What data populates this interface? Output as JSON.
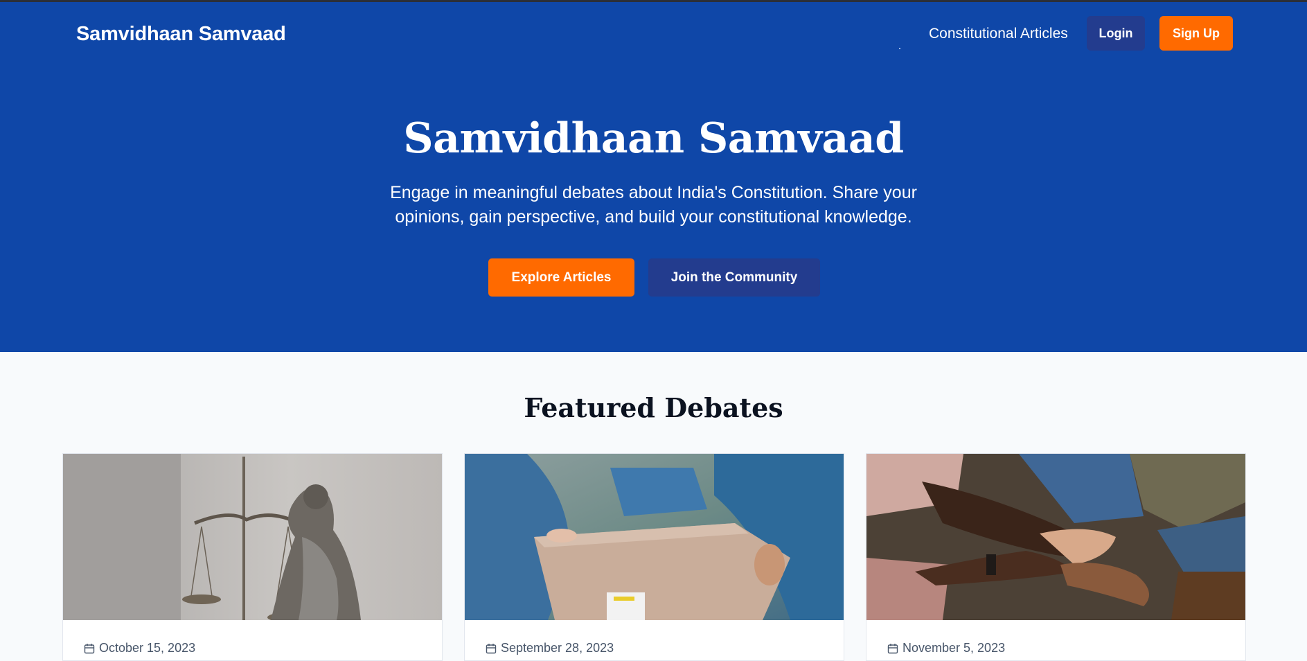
{
  "nav": {
    "brand": "Samvidhaan Samvaad",
    "articles_link": "Constitutional Articles",
    "login_label": "Login",
    "signup_label": "Sign Up"
  },
  "hero": {
    "title": "Samvidhaan Samvaad",
    "subtitle": "Engage in meaningful debates about India's Constitution. Share your opinions, gain perspective, and build your constitutional knowledge.",
    "explore_label": "Explore Articles",
    "join_label": "Join the Community"
  },
  "featured": {
    "title": "Featured Debates",
    "cards": [
      {
        "image": "lady-justice-statue",
        "date": "October 15, 2023"
      },
      {
        "image": "hands-passing-box",
        "date": "September 28, 2023"
      },
      {
        "image": "hands-stacked-together",
        "date": "November 5, 2023"
      }
    ]
  },
  "colors": {
    "primary_blue": "#0f47a8",
    "dark_blue_button": "#233c8e",
    "accent_orange": "#ff6a00",
    "page_bg": "#f8fafc"
  }
}
